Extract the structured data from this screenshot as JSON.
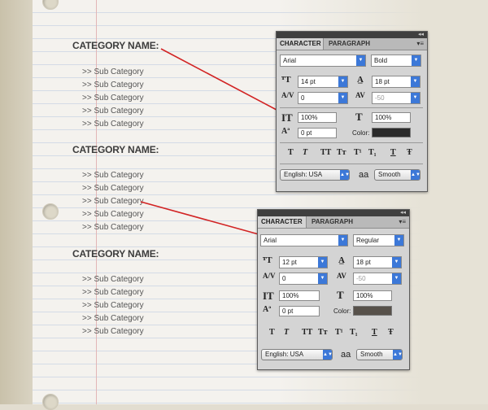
{
  "categories": [
    {
      "title": "CATEGORY NAME:",
      "items": [
        ">> Sub Category",
        ">> Sub Category",
        ">> Sub Category",
        ">> Sub Category",
        ">> Sub Category"
      ]
    },
    {
      "title": "CATEGORY NAME:",
      "items": [
        ">> Sub Category",
        ">> Sub Category",
        ">> Sub Category",
        ">> Sub Category",
        ">> Sub Category"
      ]
    },
    {
      "title": "CATEGORY NAME:",
      "items": [
        ">> Sub Category",
        ">> Sub Category",
        ">> Sub Category",
        ">> Sub Category",
        ">> Sub Category"
      ]
    }
  ],
  "panel1": {
    "tab_character": "CHARACTER",
    "tab_paragraph": "PARAGRAPH",
    "font_family": "Arial",
    "font_style": "Bold",
    "font_size": "14 pt",
    "leading": "18 pt",
    "kerning": "0",
    "tracking": "-50",
    "vscale": "100%",
    "hscale": "100%",
    "baseline": "0 pt",
    "color_label": "Color:",
    "color": "#2b2b2b",
    "language": "English: USA",
    "antialias": "Smooth"
  },
  "panel2": {
    "tab_character": "CHARACTER",
    "tab_paragraph": "PARAGRAPH",
    "font_family": "Arial",
    "font_style": "Regular",
    "font_size": "12 pt",
    "leading": "18 pt",
    "kerning": "0",
    "tracking": "-50",
    "vscale": "100%",
    "hscale": "100%",
    "baseline": "0 pt",
    "color_label": "Color:",
    "color": "#57514a",
    "language": "English: USA",
    "antialias": "Smooth"
  },
  "style_buttons": [
    "T",
    "T",
    "TT",
    "Tт",
    "T¹",
    "T₁",
    "T",
    "Ŧ"
  ],
  "aa_glyph": "aa",
  "connector_color": "#d22424"
}
